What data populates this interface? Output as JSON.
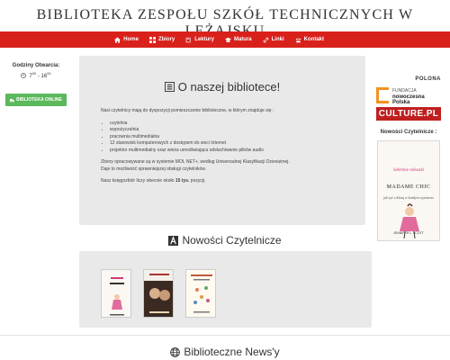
{
  "header": {
    "title": "BIBLIOTEKA ZESPOŁU SZKÓŁ TECHNICZNYCH W LEŻAJSKU"
  },
  "nav": [
    {
      "label": "Home",
      "icon": "home-icon"
    },
    {
      "label": "Zbiory",
      "icon": "grid-icon"
    },
    {
      "label": "Lektury",
      "icon": "book-icon"
    },
    {
      "label": "Matura",
      "icon": "mortarboard-icon"
    },
    {
      "label": "Linki",
      "icon": "link-icon"
    },
    {
      "label": "Kontakt",
      "icon": "phone-icon"
    }
  ],
  "sidebar": {
    "hours_label": "Godziny Otwarcia:",
    "hours_open": "7",
    "hours_open_min": "00",
    "hours_sep": " - ",
    "hours_close": "16",
    "hours_close_min": "00",
    "online_button": "BIBLIOTEKA ONLINE"
  },
  "about": {
    "heading": "O naszej bibliotece!",
    "intro": "Nasi czytelnicy mają do dyspozycji pomieszczenie biblioteczne, w którym znajduje się :",
    "items": [
      "czytelnia",
      "wypożyczalnia",
      "pracownia multimedialna",
      "12 stanowisk komputerowych z dostępem do sieci Internet",
      "projektor multimedialny oraz wieża umożliwiająca odsłuchiwanie plików audio"
    ],
    "p2a": "Zbiory opracowywane są w systemie MOL NET+, według Uniwersalnej Klasyfikacji Dziesiętnej.",
    "p2b": "Daje to możliwość sprawniejszej obsługi czytelników.",
    "p3_pre": "Nasz księgozbiór liczy obecnie około ",
    "p3_bold": "15 tys.",
    "p3_post": " pozycji."
  },
  "right": {
    "polona_small": "POLONA",
    "fnp_line1": "FUNDACJA",
    "fnp_line2": "nowoczesna",
    "fnp_line3": "Polska",
    "culture": "CULTURE.PL",
    "novelties_label": "Nowości Czytelnicze :",
    "featured_title1": "Sekretne miłostki",
    "featured_title2": "MADAME CHIC",
    "featured_sub": "jak żyć z klasą w każdym wymiarze",
    "featured_author": "JENNIFER L. SCOTT"
  },
  "novelties": {
    "heading": "Nowości Czytelnicze"
  },
  "news": {
    "heading": "Biblioteczne News'y"
  },
  "colors": {
    "nav_red": "#d9211c",
    "online_green": "#5cb85c",
    "panel_gray": "#e9e9e9"
  }
}
